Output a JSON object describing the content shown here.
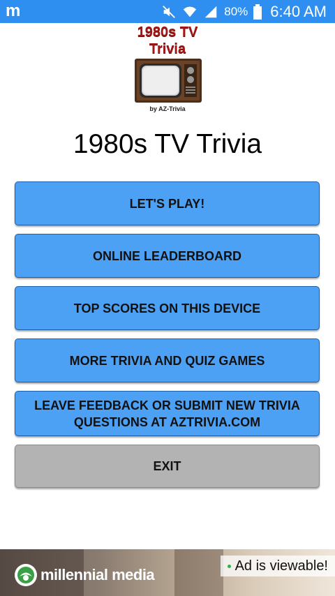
{
  "statusbar": {
    "left_icon": "m",
    "battery": "80%",
    "time": "6:40 AM",
    "icons": [
      "mute-icon",
      "wifi-icon",
      "signal-icon",
      "battery-icon"
    ]
  },
  "logo": {
    "line1": "1980s TV",
    "line2": "Trivia",
    "byline": "by AZ-Trivia"
  },
  "title": "1980s TV Trivia",
  "buttons": [
    {
      "label": "LET'S PLAY!"
    },
    {
      "label": "ONLINE LEADERBOARD"
    },
    {
      "label": "TOP SCORES ON THIS DEVICE"
    },
    {
      "label": "MORE TRIVIA AND QUIZ GAMES"
    },
    {
      "label": "LEAVE FEEDBACK OR SUBMIT NEW TRIVIA QUESTIONS AT AZTRIVIA.COM"
    },
    {
      "label": "EXIT"
    }
  ],
  "ad": {
    "brand": "millennial media",
    "status": "Ad is viewable!"
  },
  "colors": {
    "statusbar": "#2f8ff0",
    "button_blue": "#4da1f4",
    "button_gray": "#b3b3b3",
    "logo_red": "#a31616"
  }
}
